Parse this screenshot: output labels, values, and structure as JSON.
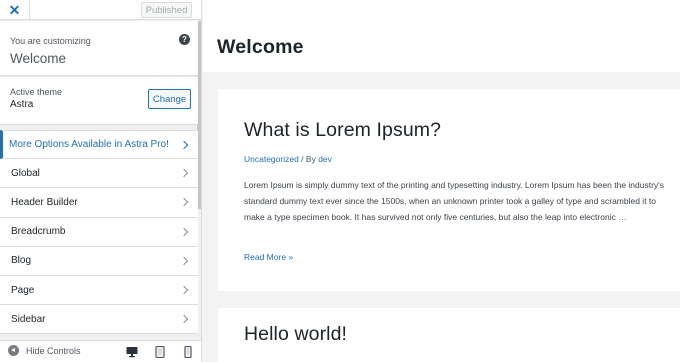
{
  "sidebar": {
    "close_label": "✕",
    "published_label": "Published",
    "customizing_label": "You are customizing",
    "customizing_title": "Welcome",
    "help_icon": "?",
    "active_theme_label": "Active theme",
    "active_theme_name": "Astra",
    "change_label": "Change",
    "pro_label": "More Options Available in Astra Pro!",
    "items": [
      {
        "label": "Global"
      },
      {
        "label": "Header Builder"
      },
      {
        "label": "Breadcrumb"
      },
      {
        "label": "Blog"
      },
      {
        "label": "Page"
      },
      {
        "label": "Sidebar"
      }
    ],
    "footer": {
      "hide_controls_label": "Hide Controls",
      "devices": [
        "desktop-icon",
        "tablet-icon",
        "mobile-icon"
      ]
    }
  },
  "preview": {
    "site_title": "Welcome",
    "posts": [
      {
        "title": "What is Lorem Ipsum?",
        "category": "Uncategorized",
        "separator": " / By ",
        "author": "dev",
        "excerpt": "Lorem Ipsum is simply dummy text of the printing and typesetting industry. Lorem Ipsum has been the industry's standard dummy text ever since the 1500s, when an unknown printer took a galley of type and scrambled it to make a type specimen book. It has survived not only five centuries, but also the leap into electronic …",
        "read_more": "Read More »"
      },
      {
        "title": "Hello world!"
      }
    ]
  },
  "colors": {
    "accent": "#2271b1",
    "sidebar_bg": "#f0f0f1",
    "preview_bg": "#f3f3f4"
  }
}
